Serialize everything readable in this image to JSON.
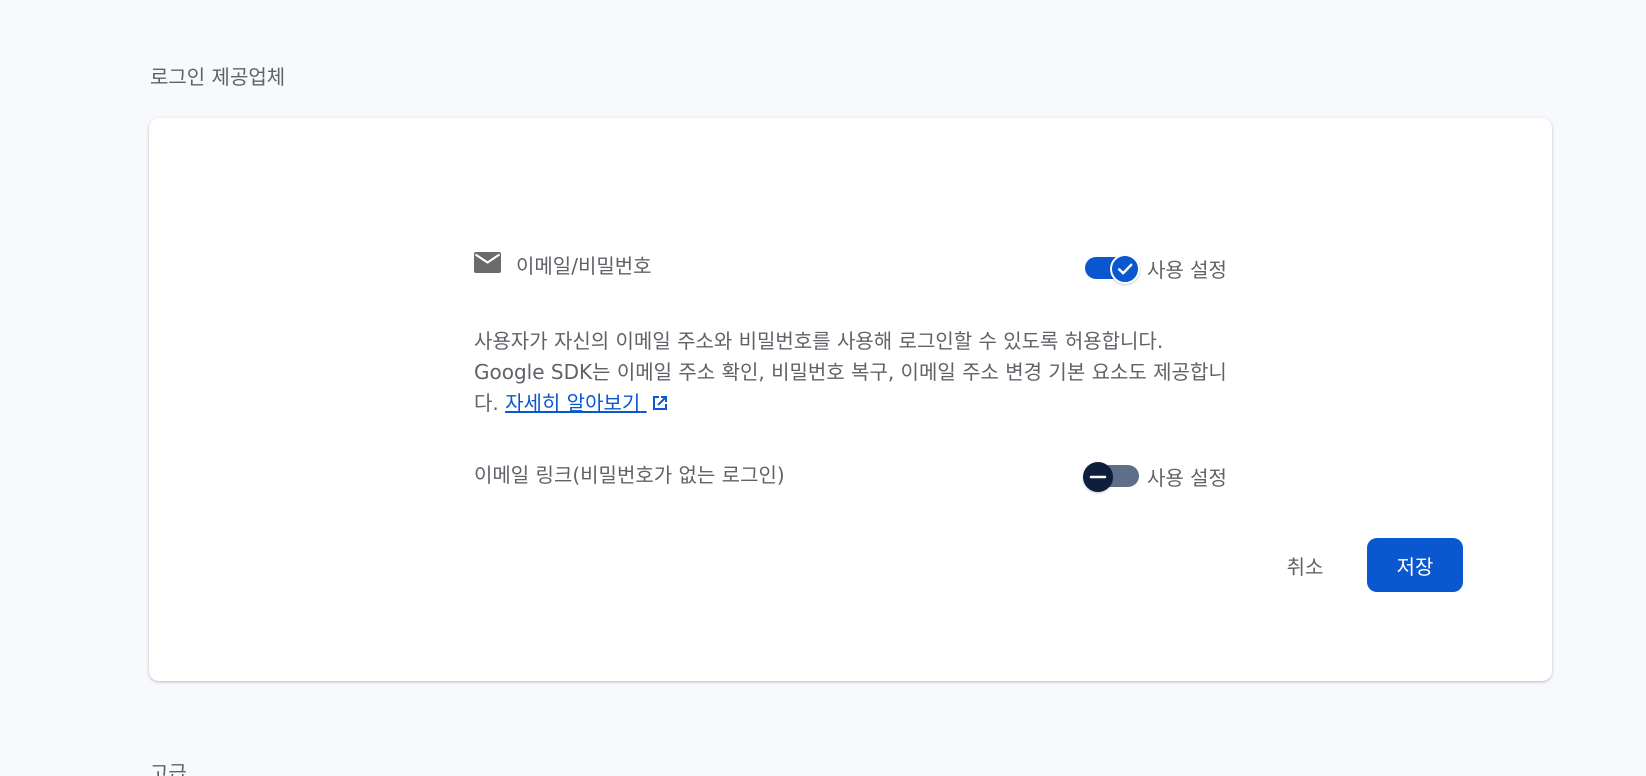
{
  "section": {
    "title": "로그인 제공업체",
    "next_title": "고급"
  },
  "providers": [
    {
      "icon": "mail-icon",
      "label": "이메일/비밀번호",
      "toggle_label": "사용 설정",
      "enabled": true
    },
    {
      "label": "이메일 링크(비밀번호가 없는 로그인)",
      "toggle_label": "사용 설정",
      "enabled": false
    }
  ],
  "description": {
    "text": "사용자가 자신의 이메일 주소와 비밀번호를 사용해 로그인할 수 있도록 허용합니다. Google SDK는 이메일 주소 확인, 비밀번호 복구, 이메일 주소 변경 기본 요소도 제공합니다.",
    "link_label": "자세히 알아보기",
    "link_icon": "external-link-icon"
  },
  "actions": {
    "cancel_label": "취소",
    "save_label": "저장"
  },
  "colors": {
    "accent": "#0b57d0",
    "background": "#f8f9fd",
    "card": "#ffffff",
    "text": "#5f6368",
    "toggle_off_track": "#5f6f8a",
    "toggle_off_thumb": "#0d1f3d"
  }
}
